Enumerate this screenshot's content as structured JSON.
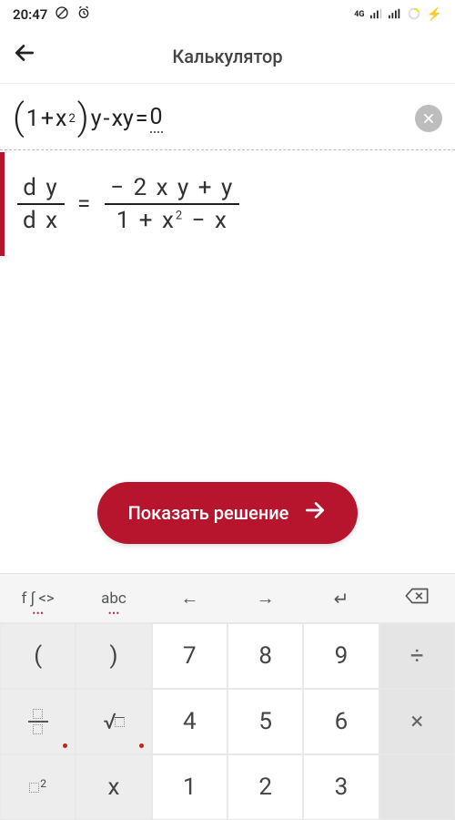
{
  "status": {
    "time": "20:47",
    "network_label": "4G"
  },
  "header": {
    "title": "Калькулятор"
  },
  "input": {
    "expr_lparen": "(",
    "expr_1": "1",
    "expr_plus": "+",
    "expr_x": "x",
    "expr_sq": "2",
    "expr_rparen": ")",
    "expr_y": "y",
    "expr_minus": "-",
    "expr_xy": "xy",
    "expr_eq": "=",
    "expr_zero": "0"
  },
  "result": {
    "lhs_num": "d y",
    "lhs_den": "d x",
    "eq": "=",
    "rhs_num": "− 2 x y + y",
    "rhs_den_a": "1 + x",
    "rhs_den_exp": "2",
    "rhs_den_b": " − x"
  },
  "cta": {
    "label": "Показать решение"
  },
  "keyboard": {
    "tabs": {
      "functions": "f ∫ <>",
      "abc": "abc",
      "left": "←",
      "right": "→",
      "newline": "↵",
      "backspace": "⌫"
    },
    "row1": {
      "k0": "(",
      "k1": ")",
      "k2": "7",
      "k3": "8",
      "k4": "9",
      "k5": "÷"
    },
    "row2": {
      "k2": "4",
      "k3": "5",
      "k4": "6",
      "k5": "×"
    },
    "row3": {
      "k1": "x",
      "k2": "1",
      "k3": "2",
      "k4": "3"
    }
  }
}
